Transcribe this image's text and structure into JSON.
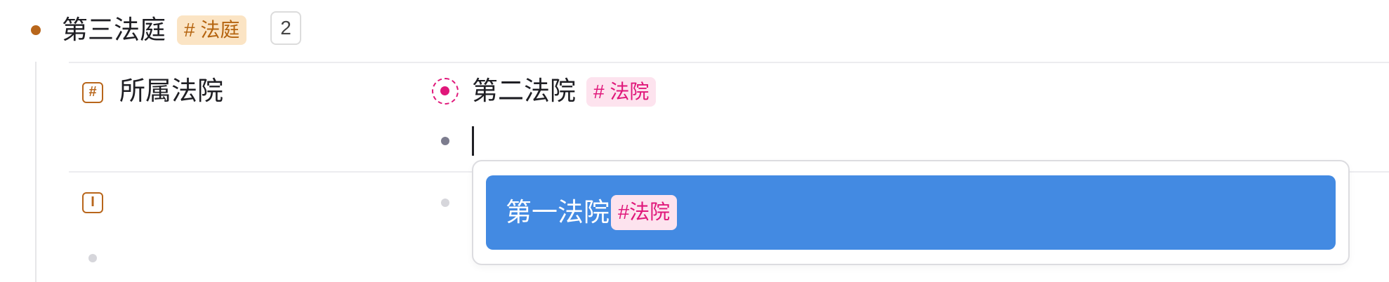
{
  "node": {
    "title": "第三法庭",
    "tag": "# 法庭",
    "count": "2"
  },
  "field": {
    "icon": "hash-field-icon",
    "label": "所属法院",
    "value": {
      "text": "第二法院",
      "tag": "# 法院"
    },
    "input_value": ""
  },
  "second_field": {
    "icon": "text-field-icon"
  },
  "dropdown": {
    "items": [
      {
        "label": "第一法院",
        "tag": "#法院",
        "selected": true
      }
    ]
  },
  "colors": {
    "accent_orange": "#b8661b",
    "accent_pink": "#e0177a",
    "selection_blue": "#438ae2"
  }
}
